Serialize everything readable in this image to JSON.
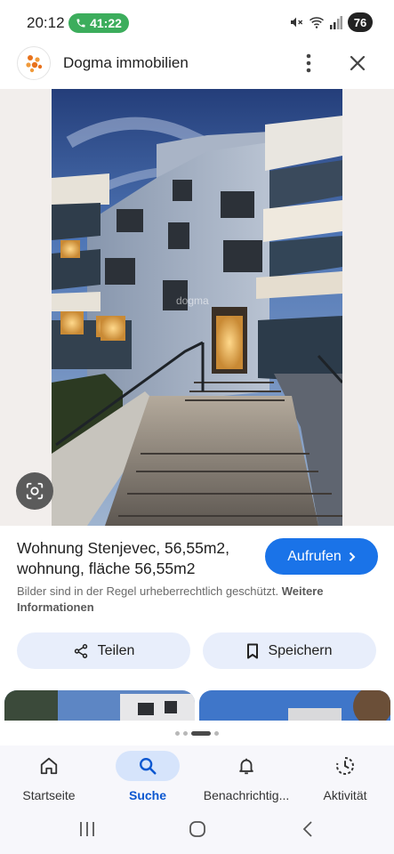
{
  "status_bar": {
    "time": "20:12",
    "call_timer": "41:22",
    "battery": "76"
  },
  "header": {
    "site_name": "Dogma immobilien"
  },
  "result": {
    "title": "Wohnung Stenjevec, 56,55m2, wohnung, fläche 56,55m2",
    "visit_label": "Aufrufen",
    "copyright_text": "Bilder sind in der Regel urheberrechtlich geschützt.",
    "copyright_link": "Weitere Informationen",
    "watermark": "dogma"
  },
  "actions": {
    "share_label": "Teilen",
    "save_label": "Speichern"
  },
  "bottom_nav": [
    {
      "label": "Startseite",
      "icon": "home-icon",
      "active": false
    },
    {
      "label": "Suche",
      "icon": "search-icon",
      "active": true
    },
    {
      "label": "Benachrichtig...",
      "icon": "bell-icon",
      "active": false
    },
    {
      "label": "Aktivität",
      "icon": "history-icon",
      "active": false
    }
  ],
  "colors": {
    "accent": "#1a73e8",
    "active_nav_pill": "#d6e4fb",
    "call_green": "#3cad5c",
    "action_button_bg": "#e8eefb"
  }
}
